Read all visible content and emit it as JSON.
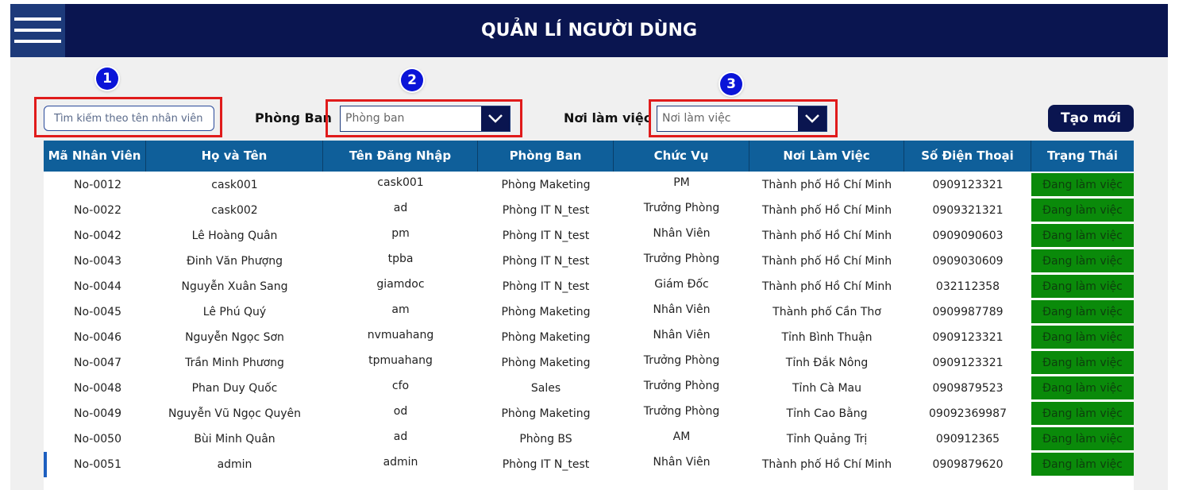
{
  "header": {
    "title": "QUẢN LÍ NGƯỜI DÙNG",
    "menu_icon": "hamburger-menu-icon"
  },
  "badges": [
    "1",
    "2",
    "3"
  ],
  "filters": {
    "search_placeholder": "Tìm kiếm theo tên nhân viên",
    "department_label": "Phòng Ban",
    "department_placeholder": "Phòng ban",
    "workplace_label": "Nơi làm việc",
    "workplace_placeholder": "Nơi làm việc"
  },
  "create_button": "Tạo mới",
  "colors": {
    "header_bg": "#0a1550",
    "table_header_bg": "#0f5f9a",
    "status_bg": "#0a8a0a",
    "highlight_border": "#e01b1b",
    "badge_bg": "#0a14d8"
  },
  "table": {
    "columns": [
      "Mã Nhân Viên",
      "Họ và Tên",
      "Tên Đăng Nhập",
      "Phòng Ban",
      "Chức Vụ",
      "Nơi Làm Việc",
      "Số Điện Thoại",
      "Trạng Thái"
    ],
    "rows": [
      [
        "No-0012",
        "cask001",
        "cask001",
        "Phòng Maketing",
        "PM",
        "Thành phố Hồ Chí Minh",
        "0909123321",
        "Đang làm việc"
      ],
      [
        "No-0022",
        "cask002",
        "ad",
        "Phòng IT N_test",
        "Trưởng Phòng",
        "Thành phố Hồ Chí Minh",
        "0909321321",
        "Đang làm việc"
      ],
      [
        "No-0042",
        "Lê Hoàng Quân",
        "pm",
        "Phòng IT N_test",
        "Nhân Viên",
        "Thành phố Hồ Chí Minh",
        "0909090603",
        "Đang làm việc"
      ],
      [
        "No-0043",
        "Đinh Văn Phượng",
        "tpba",
        "Phòng IT N_test",
        "Trưởng Phòng",
        "Thành phố Hồ Chí Minh",
        "0909030609",
        "Đang làm việc"
      ],
      [
        "No-0044",
        "Nguyễn Xuân Sang",
        "giamdoc",
        "Phòng IT N_test",
        "Giám Đốc",
        "Thành phố Hồ Chí Minh",
        "032112358",
        "Đang làm việc"
      ],
      [
        "No-0045",
        "Lê Phú Quý",
        "am",
        "Phòng Maketing",
        "Nhân Viên",
        "Thành phố Cần Thơ",
        "0909987789",
        "Đang làm việc"
      ],
      [
        "No-0046",
        "Nguyễn Ngọc Sơn",
        "nvmuahang",
        "Phòng Maketing",
        "Nhân Viên",
        "Tỉnh Bình Thuận",
        "0909123321",
        "Đang làm việc"
      ],
      [
        "No-0047",
        "Trần Minh Phương",
        "tpmuahang",
        "Phòng Maketing",
        "Trưởng Phòng",
        "Tỉnh Đắk Nông",
        "0909123321",
        "Đang làm việc"
      ],
      [
        "No-0048",
        "Phan Duy Quốc",
        "cfo",
        "Sales",
        "Trưởng Phòng",
        "Tỉnh Cà Mau",
        "0909879523",
        "Đang làm việc"
      ],
      [
        "No-0049",
        "Nguyễn Vũ Ngọc Quyên",
        "od",
        "Phòng Maketing",
        "Trưởng Phòng",
        "Tỉnh Cao Bằng",
        "09092369987",
        "Đang làm việc"
      ],
      [
        "No-0050",
        "Bùi Minh Quân",
        "ad",
        "Phòng BS",
        "AM",
        "Tỉnh Quảng Trị",
        "090912365",
        "Đang làm việc"
      ],
      [
        "No-0051",
        "admin",
        "admin",
        "Phòng IT N_test",
        "Nhân Viên",
        "Thành phố Hồ Chí Minh",
        "0909879620",
        "Đang làm việc"
      ]
    ]
  }
}
